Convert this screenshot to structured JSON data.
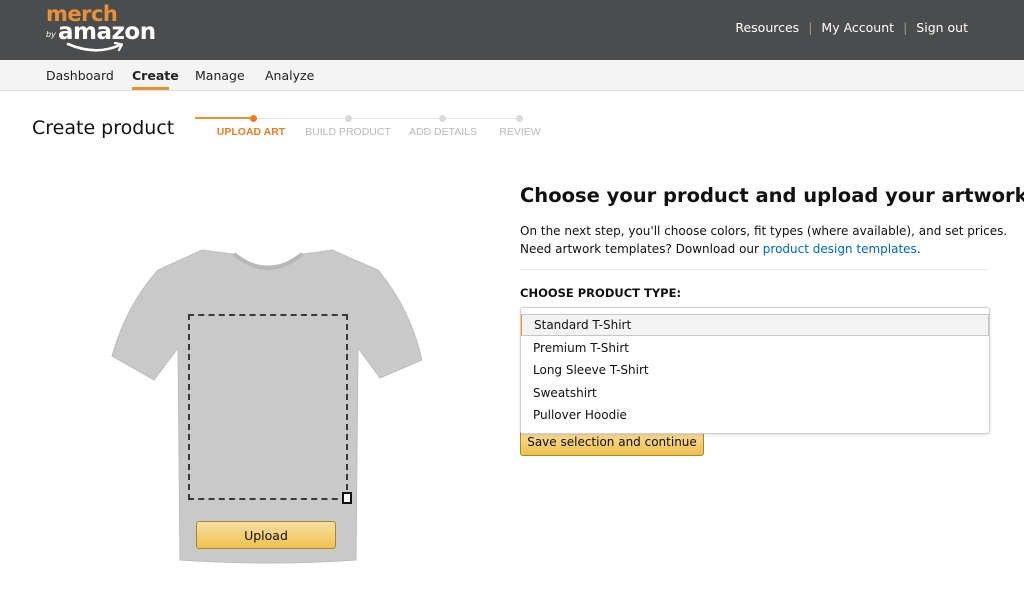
{
  "header": {
    "logo": {
      "top_word": "merch",
      "by_word": "by",
      "brand_word": "amazon"
    },
    "links": [
      {
        "label": "Resources"
      },
      {
        "label": "My Account"
      },
      {
        "label": "Sign out"
      }
    ],
    "separator": "|"
  },
  "nav": {
    "items": [
      {
        "label": "Dashboard",
        "active": false
      },
      {
        "label": "Create",
        "active": true
      },
      {
        "label": "Manage",
        "active": false
      },
      {
        "label": "Analyze",
        "active": false
      }
    ]
  },
  "page": {
    "title": "Create product",
    "progress": {
      "current_step": 1,
      "steps": [
        {
          "label": "UPLOAD ART",
          "active": true
        },
        {
          "label": "BUILD PRODUCT",
          "active": false
        },
        {
          "label": "ADD DETAILS",
          "active": false
        },
        {
          "label": "REVIEW",
          "active": false
        }
      ]
    }
  },
  "preview": {
    "shirt_color": "#c8c8c8",
    "upload_label": "Upload"
  },
  "form": {
    "heading": "Choose your product and upload your artwork",
    "description_line1": "On the next step, you'll choose colors, fit types (where available), and set prices.",
    "description_line2_prefix": "Need artwork templates? Download our ",
    "description_link": "product design templates",
    "description_line2_suffix": ".",
    "product_type_label": "CHOOSE PRODUCT TYPE:",
    "product_type_selected": "Standard T-Shirt",
    "product_type_options": [
      "Standard T-Shirt",
      "Premium T-Shirt",
      "Long Sleeve T-Shirt",
      "Sweatshirt",
      "Pullover Hoodie"
    ],
    "save_label": "Save selection and continue"
  },
  "colors": {
    "accent": "#e9913a",
    "header_bg": "#4a4c4d",
    "link": "#0066c0",
    "button_yellow": "#f0c14b"
  }
}
